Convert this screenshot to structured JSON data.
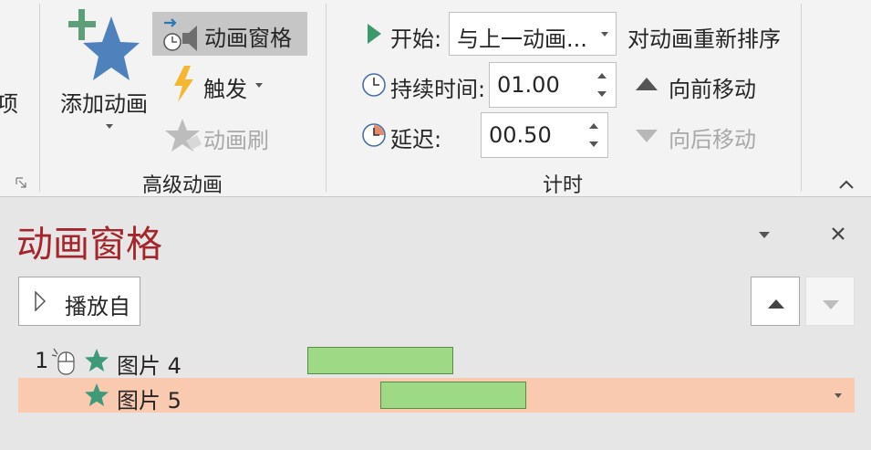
{
  "ribbon": {
    "left_partial_label": "项",
    "add_animation": {
      "label": "添加动画"
    },
    "animation_pane_btn": {
      "label": "动画窗格"
    },
    "trigger_btn": {
      "label": "触发"
    },
    "animation_painter_btn": {
      "label": "动画刷"
    },
    "advanced_group_label": "高级动画",
    "start": {
      "label": "开始:",
      "value": "与上一动画..."
    },
    "duration": {
      "label": "持续时间:",
      "value": "01.00"
    },
    "delay": {
      "label": "延迟:",
      "value": "00.50"
    },
    "reorder_label": "对动画重新排序",
    "move_earlier": "向前移动",
    "move_later": "向后移动",
    "timing_group_label": "计时"
  },
  "pane": {
    "title": "动画窗格",
    "play_from_label": "播放自",
    "items": [
      {
        "number": "1",
        "name": "图片 4",
        "selected": false
      },
      {
        "number": "",
        "name": "图片 5",
        "selected": true
      }
    ]
  },
  "colors": {
    "star": "#4f81bd",
    "pane_title": "#a4262c",
    "effect_star": "#3f9a7a",
    "timeline_bar": "#9ed986",
    "selected_row": "#f9c9b0"
  }
}
